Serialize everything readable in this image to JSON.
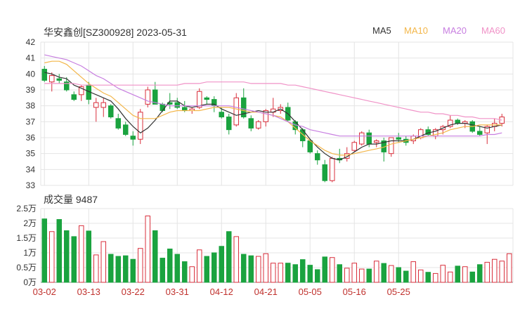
{
  "header": {
    "title": "华安鑫创[SZ300928] 2023-05-31"
  },
  "legend": [
    {
      "label": "MA5",
      "color": "#333333"
    },
    {
      "label": "MA10",
      "color": "#f3b649"
    },
    {
      "label": "MA20",
      "color": "#c77ee0"
    },
    {
      "label": "MA60",
      "color": "#f092c7"
    }
  ],
  "volume_label": "成交量 9487",
  "colors": {
    "up": "#d92f3c",
    "down": "#1aa33f",
    "grid": "#e4e4e4",
    "axis": "#333333"
  },
  "chart_data": [
    {
      "type": "candlestick",
      "ylim": [
        33,
        42
      ],
      "yticks": [
        33,
        34,
        35,
        36,
        37,
        38,
        39,
        40,
        41,
        42
      ],
      "x_labels": [
        "03-02",
        "03-13",
        "03-22",
        "03-31",
        "04-12",
        "04-21",
        "05-05",
        "05-16",
        "05-25"
      ],
      "x_label_index": [
        0,
        6,
        12,
        18,
        24,
        30,
        36,
        42,
        48
      ],
      "ohlc": [
        [
          40.3,
          40.5,
          39.5,
          39.6
        ],
        [
          39.5,
          40.1,
          38.9,
          39.9
        ],
        [
          39.7,
          40.0,
          39.4,
          39.6
        ],
        [
          39.5,
          39.8,
          38.9,
          39.0
        ],
        [
          38.7,
          38.9,
          38.3,
          38.4
        ],
        [
          38.7,
          39.3,
          38.3,
          39.2
        ],
        [
          39.3,
          39.5,
          38.1,
          38.4
        ],
        [
          37.9,
          38.5,
          37.0,
          38.2
        ],
        [
          37.9,
          38.5,
          37.3,
          38.2
        ],
        [
          38.0,
          38.1,
          37.2,
          37.3
        ],
        [
          37.2,
          37.5,
          36.5,
          36.6
        ],
        [
          36.8,
          37.0,
          36.1,
          36.2
        ],
        [
          36.1,
          36.4,
          35.5,
          35.9
        ],
        [
          35.9,
          37.8,
          35.6,
          37.6
        ],
        [
          38.1,
          39.2,
          37.9,
          39.0
        ],
        [
          39.0,
          39.5,
          38.2,
          38.1
        ],
        [
          38.1,
          38.2,
          37.6,
          37.7
        ],
        [
          38.2,
          38.8,
          37.8,
          38.1
        ],
        [
          38.2,
          38.5,
          37.8,
          37.9
        ],
        [
          37.9,
          38.3,
          37.6,
          37.7
        ],
        [
          37.7,
          37.9,
          37.5,
          37.8
        ],
        [
          37.9,
          39.1,
          37.8,
          38.9
        ],
        [
          38.5,
          38.6,
          38.1,
          38.4
        ],
        [
          38.4,
          38.6,
          37.6,
          38.0
        ],
        [
          37.6,
          37.9,
          37.2,
          37.3
        ],
        [
          37.3,
          37.5,
          36.2,
          36.5
        ],
        [
          36.8,
          38.8,
          36.7,
          38.5
        ],
        [
          38.5,
          39.1,
          37.2,
          37.3
        ],
        [
          37.2,
          37.4,
          36.4,
          36.6
        ],
        [
          36.6,
          37.1,
          36.5,
          37.0
        ],
        [
          37.0,
          37.8,
          36.7,
          37.7
        ],
        [
          37.6,
          38.5,
          37.3,
          37.8
        ],
        [
          37.7,
          38.1,
          37.5,
          37.9
        ],
        [
          37.9,
          38.2,
          37.0,
          37.1
        ],
        [
          37.0,
          37.1,
          36.2,
          36.5
        ],
        [
          36.5,
          36.6,
          35.4,
          35.8
        ],
        [
          35.8,
          35.9,
          35.0,
          35.1
        ],
        [
          35.0,
          35.2,
          34.3,
          34.6
        ],
        [
          34.3,
          34.6,
          33.2,
          33.3
        ],
        [
          33.3,
          34.8,
          33.2,
          34.7
        ],
        [
          34.7,
          35.3,
          34.4,
          34.6
        ],
        [
          34.7,
          35.4,
          34.5,
          35.0
        ],
        [
          35.2,
          35.8,
          35.1,
          35.7
        ],
        [
          35.6,
          36.4,
          35.5,
          36.3
        ],
        [
          36.3,
          36.5,
          35.4,
          35.6
        ],
        [
          35.7,
          35.9,
          35.4,
          35.8
        ],
        [
          35.8,
          36.0,
          34.5,
          35.1
        ],
        [
          35.0,
          36.0,
          34.8,
          36.0
        ],
        [
          36.0,
          36.3,
          35.7,
          35.9
        ],
        [
          35.9,
          36.1,
          35.5,
          35.7
        ],
        [
          35.8,
          36.2,
          35.6,
          36.1
        ],
        [
          36.0,
          36.6,
          35.9,
          36.5
        ],
        [
          36.5,
          36.7,
          36.1,
          36.2
        ],
        [
          36.1,
          36.6,
          35.9,
          36.5
        ],
        [
          36.5,
          36.8,
          36.2,
          36.7
        ],
        [
          36.7,
          37.4,
          36.6,
          37.1
        ],
        [
          37.1,
          37.2,
          36.8,
          36.9
        ],
        [
          36.9,
          37.1,
          36.6,
          37.0
        ],
        [
          37.0,
          37.1,
          36.3,
          36.4
        ],
        [
          36.4,
          36.7,
          36.1,
          36.2
        ],
        [
          36.3,
          36.8,
          35.6,
          36.7
        ],
        [
          36.7,
          37.2,
          36.4,
          36.9
        ],
        [
          36.9,
          37.5,
          36.7,
          37.3
        ]
      ],
      "ma": {
        "MA5": [
          40.1,
          40.0,
          39.8,
          39.7,
          39.3,
          39.1,
          38.9,
          38.7,
          38.5,
          38.3,
          37.8,
          37.2,
          36.7,
          36.3,
          36.6,
          37.1,
          37.7,
          38.3,
          38.3,
          38.0,
          37.9,
          38.0,
          38.1,
          38.1,
          37.8,
          37.6,
          37.4,
          37.5,
          37.6,
          37.7,
          37.6,
          37.6,
          37.8,
          37.5,
          37.0,
          36.5,
          35.9,
          35.4,
          35.0,
          34.7,
          34.6,
          34.8,
          35.1,
          35.4,
          35.6,
          35.6,
          35.7,
          35.8,
          35.8,
          35.8,
          35.9,
          36.1,
          36.3,
          36.4,
          36.6,
          36.8,
          36.9,
          36.9,
          36.8,
          36.7,
          36.6,
          36.7,
          36.8
        ],
        "MA10": [
          40.7,
          40.8,
          40.8,
          40.6,
          40.2,
          39.8,
          39.4,
          39.1,
          38.8,
          38.6,
          38.2,
          37.8,
          37.4,
          37.2,
          37.2,
          37.2,
          37.4,
          37.6,
          37.7,
          37.7,
          37.7,
          37.7,
          37.8,
          37.9,
          37.9,
          37.9,
          37.8,
          37.7,
          37.6,
          37.6,
          37.5,
          37.4,
          37.3,
          37.0,
          36.6,
          36.2,
          35.8,
          35.5,
          35.2,
          35.0,
          34.9,
          34.9,
          35.0,
          35.1,
          35.2,
          35.3,
          35.4,
          35.6,
          35.7,
          35.8,
          35.9,
          36.0,
          36.1,
          36.2,
          36.3,
          36.5,
          36.6,
          36.7,
          36.7,
          36.8,
          36.8,
          36.8,
          36.8
        ],
        "MA20": [
          41.2,
          41.1,
          41.0,
          40.9,
          40.7,
          40.5,
          40.2,
          39.9,
          39.7,
          39.4,
          39.1,
          38.9,
          38.7,
          38.5,
          38.3,
          38.2,
          38.1,
          38.0,
          38.0,
          38.0,
          38.0,
          38.0,
          38.0,
          38.0,
          38.0,
          38.0,
          37.9,
          37.8,
          37.7,
          37.6,
          37.5,
          37.4,
          37.2,
          37.0,
          36.8,
          36.7,
          36.5,
          36.4,
          36.3,
          36.2,
          36.1,
          36.1,
          36.1,
          36.1,
          36.1,
          36.1,
          36.1,
          36.1,
          36.1,
          36.1,
          36.1,
          36.1,
          36.1,
          36.1,
          36.1,
          36.1,
          36.1,
          36.1,
          36.1,
          36.1,
          36.2,
          36.2,
          36.3
        ],
        "MA60": [
          39.4,
          39.4,
          39.4,
          39.4,
          39.4,
          39.3,
          39.3,
          39.3,
          39.3,
          39.3,
          39.3,
          39.3,
          39.3,
          39.3,
          39.3,
          39.3,
          39.3,
          39.3,
          39.3,
          39.4,
          39.4,
          39.4,
          39.5,
          39.5,
          39.5,
          39.5,
          39.5,
          39.5,
          39.4,
          39.4,
          39.4,
          39.4,
          39.4,
          39.3,
          39.3,
          39.2,
          39.1,
          39.0,
          38.9,
          38.8,
          38.7,
          38.6,
          38.5,
          38.4,
          38.3,
          38.2,
          38.1,
          38.0,
          37.9,
          37.8,
          37.7,
          37.6,
          37.6,
          37.5,
          37.5,
          37.4,
          37.4,
          37.3,
          37.3,
          37.2,
          37.2,
          37.2,
          37.1
        ]
      }
    },
    {
      "type": "bar",
      "unit": "万",
      "ylim": [
        0,
        2.5
      ],
      "ytick_labels": [
        "0万",
        "0.5万",
        "1万",
        "1.5万",
        "2万",
        "2.5万"
      ],
      "yticks": [
        0,
        0.5,
        1,
        1.5,
        2,
        2.5
      ],
      "values": [
        2.15,
        1.72,
        2.13,
        1.75,
        1.55,
        1.92,
        1.74,
        0.93,
        1.38,
        0.95,
        0.88,
        0.9,
        0.78,
        1.15,
        2.25,
        1.75,
        0.82,
        1.13,
        0.95,
        0.7,
        0.53,
        1.1,
        0.88,
        1.0,
        1.22,
        1.72,
        1.55,
        0.95,
        0.9,
        0.88,
        0.97,
        0.65,
        0.65,
        0.65,
        0.6,
        0.77,
        0.58,
        0.43,
        0.86,
        0.84,
        0.6,
        0.48,
        0.65,
        0.45,
        0.45,
        0.72,
        0.64,
        0.57,
        0.5,
        0.38,
        0.7,
        0.42,
        0.34,
        0.3,
        0.58,
        0.35,
        0.55,
        0.53,
        0.35,
        0.6,
        0.68,
        0.78,
        0.72,
        0.97
      ]
    }
  ]
}
